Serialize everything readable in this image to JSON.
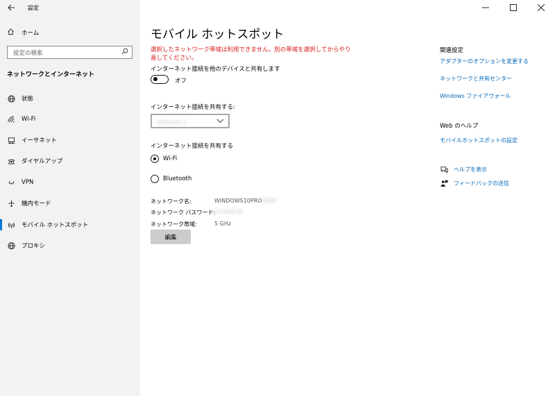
{
  "window": {
    "title": "設定"
  },
  "sidebar": {
    "home_label": "ホーム",
    "search_placeholder": "設定の検索",
    "section_heading": "ネットワークとインターネット",
    "items": [
      {
        "label": "状態",
        "icon": "globe-icon"
      },
      {
        "label": "Wi-Fi",
        "icon": "wifi-icon"
      },
      {
        "label": "イーサネット",
        "icon": "ethernet-icon"
      },
      {
        "label": "ダイヤルアップ",
        "icon": "dialup-icon"
      },
      {
        "label": "VPN",
        "icon": "vpn-icon"
      },
      {
        "label": "機内モード",
        "icon": "airplane-icon"
      },
      {
        "label": "モバイル ホットスポット",
        "icon": "hotspot-icon",
        "selected": true
      },
      {
        "label": "プロキシ",
        "icon": "globe-icon"
      }
    ]
  },
  "main": {
    "title": "モバイル ホットスポット",
    "error_message": "選択したネットワーク帯域は利用できません。別の帯域を選択してからやり直してください。",
    "share_with_others_label": "インターネット接続を他のデバイスと共有します",
    "toggle_state": "オフ",
    "share_from_label": "インターネット接続を共有する:",
    "share_from_value": "Ethernet 2",
    "share_over_label": "インターネット接続を共有する",
    "share_over_options": [
      {
        "label": "Wi-Fi",
        "selected": true
      },
      {
        "label": "Bluetooth",
        "selected": false
      }
    ],
    "properties": {
      "network_name_label": "ネットワーク名:",
      "network_name_value": "WINDOWS10PRO",
      "network_name_blurred": " 0000",
      "password_label": "ネットワーク パスワード:",
      "password_value": "12345678",
      "band_label": "ネットワーク帯域:",
      "band_value": "5 GHz"
    },
    "edit_button": "編集"
  },
  "right_panel": {
    "related_heading": "関連設定",
    "related_links": [
      "アダプターのオプションを変更する",
      "ネットワークと共有センター",
      "Windows ファイアウォール"
    ],
    "web_help_heading": "Web のヘルプ",
    "web_help_link": "モバイルホットスポットの設定",
    "help_label": "ヘルプを表示",
    "feedback_label": "フィードバックの送信"
  },
  "colors": {
    "link": "#0067b8",
    "error": "#d81919",
    "accent": "#0078d7",
    "sidebar_bg": "#f2f2f2"
  }
}
